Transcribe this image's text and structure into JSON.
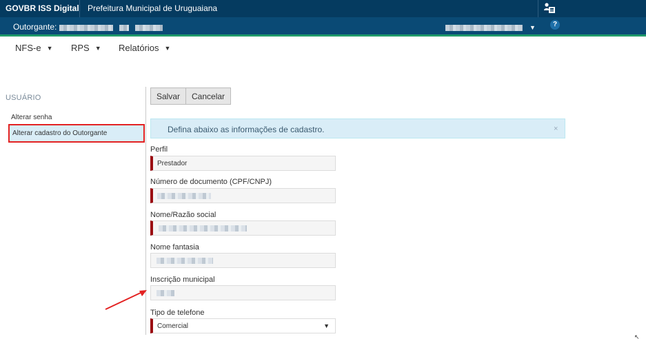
{
  "topbar": {
    "brand": "GOVBR ISS Digital",
    "municipality": "Prefeitura Municipal de Uruguaiana"
  },
  "subbar": {
    "outorgante_label": "Outorgante:",
    "help_label": "?"
  },
  "menu": {
    "items": [
      {
        "label": "NFS-e"
      },
      {
        "label": "RPS"
      },
      {
        "label": "Relatórios"
      }
    ]
  },
  "sidebar": {
    "title": "USUÁRIO",
    "items": [
      {
        "label": "Alterar senha"
      },
      {
        "label": "Alterar cadastro do Outorgante",
        "active": true
      }
    ]
  },
  "toolbar": {
    "save_label": "Salvar",
    "cancel_label": "Cancelar"
  },
  "alert": {
    "message": "Defina abaixo as informações de cadastro.",
    "close": "×"
  },
  "form": {
    "perfil_label": "Perfil",
    "perfil_value": "Prestador",
    "documento_label": "Número de documento (CPF/CNPJ)",
    "razao_label": "Nome/Razão social",
    "fantasia_label": "Nome fantasia",
    "inscricao_label": "Inscrição municipal",
    "telefone_label": "Tipo de telefone",
    "telefone_value": "Comercial"
  },
  "colors": {
    "topbar": "#053b60",
    "subbar": "#0a4a75",
    "accent_green": "#1f9a6a",
    "required_marker": "#9b0c12",
    "highlight_red": "#e32222",
    "alert_bg": "#d9edf7"
  },
  "icons": [
    "user-profile-icon",
    "help-icon",
    "dropdown-caret-icon",
    "close-icon"
  ]
}
